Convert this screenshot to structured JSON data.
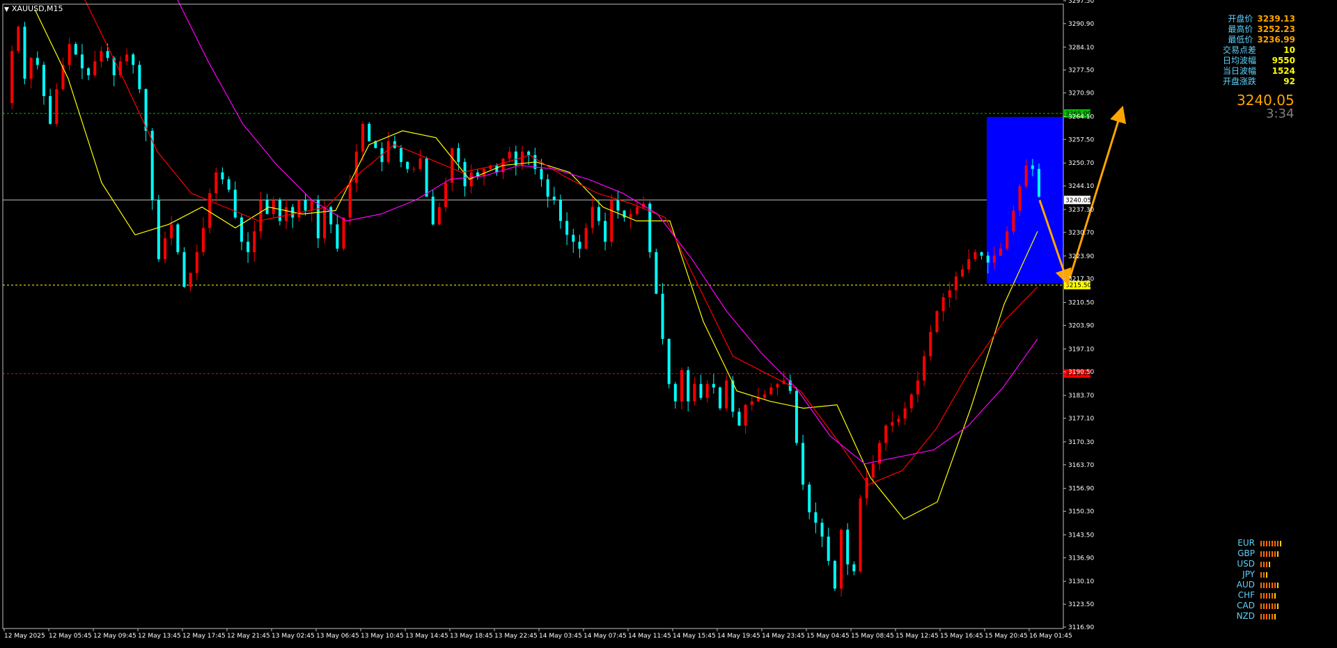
{
  "title": "XAUUSD,M15",
  "colors": {
    "background": "#000000",
    "bull_candle": "#ff0000",
    "bear_candle": "#00ffff",
    "ma_fast": "#ffff00",
    "ma_mid": "#ff0000",
    "ma_slow": "#ff00ff",
    "zone": "#0000ff",
    "arrow": "#ffa500",
    "level_high": "#00c000",
    "level_low": "#ffff00",
    "level_red": "#ff0000"
  },
  "info_panel": [
    {
      "label": "开盘价",
      "value": "3239.13",
      "color": "#ffa500"
    },
    {
      "label": "最高价",
      "value": "3252.23",
      "color": "#ffa500"
    },
    {
      "label": "最低价",
      "value": "3236.99",
      "color": "#ffa500"
    },
    {
      "label": "交易点差",
      "value": "10",
      "color": "#ffff00"
    },
    {
      "label": "日均波幅",
      "value": "9550",
      "color": "#ffff00"
    },
    {
      "label": "当日波幅",
      "value": "1524",
      "color": "#ffff00"
    },
    {
      "label": "开盘涨跌",
      "value": "92",
      "color": "#ffff00"
    }
  ],
  "current_price": "3240.05",
  "bar_timer": "3:34",
  "currency_strength": [
    {
      "code": "EUR",
      "strength": 8
    },
    {
      "code": "GBP",
      "strength": 7
    },
    {
      "code": "USD",
      "strength": 4
    },
    {
      "code": "JPY",
      "strength": 3
    },
    {
      "code": "AUD",
      "strength": 7
    },
    {
      "code": "CHF",
      "strength": 6
    },
    {
      "code": "CAD",
      "strength": 7
    },
    {
      "code": "NZD",
      "strength": 6
    }
  ],
  "chart_data": {
    "type": "candlestick",
    "symbol": "XAUUSD",
    "timeframe": "M15",
    "ylim": [
      3116.9,
      3297.5
    ],
    "y_ticks": [
      "3297.50",
      "3290.90",
      "3284.10",
      "3277.50",
      "3270.90",
      "3264.10",
      "3257.50",
      "3250.70",
      "3244.10",
      "3237.30",
      "3230.70",
      "3223.90",
      "3217.30",
      "3210.50",
      "3203.90",
      "3197.10",
      "3190.50",
      "3183.70",
      "3177.10",
      "3170.30",
      "3163.70",
      "3156.90",
      "3150.30",
      "3143.50",
      "3136.90",
      "3130.10",
      "3123.50",
      "3116.90"
    ],
    "x_ticks": [
      "12 May 2025",
      "12 May 05:45",
      "12 May 09:45",
      "12 May 13:45",
      "12 May 17:45",
      "12 May 21:45",
      "13 May 02:45",
      "13 May 06:45",
      "13 May 10:45",
      "13 May 14:45",
      "13 May 18:45",
      "13 May 22:45",
      "14 May 03:45",
      "14 May 07:45",
      "14 May 11:45",
      "14 May 15:45",
      "14 May 19:45",
      "14 May 23:45",
      "15 May 04:45",
      "15 May 08:45",
      "15 May 12:45",
      "15 May 16:45",
      "15 May 20:45",
      "16 May 01:45"
    ],
    "price_levels": [
      {
        "price": 3265.0,
        "label": "3265.00",
        "color": "#00c000"
      },
      {
        "price": 3240.05,
        "label": "3240.05",
        "color": "#c0c0c0"
      },
      {
        "price": 3215.5,
        "label": "3215.50",
        "color": "#ffff00"
      },
      {
        "price": 3190.0,
        "label": "3190.00",
        "color": "#ff0000"
      }
    ],
    "zone": {
      "top": 3264.0,
      "bottom": 3216.0,
      "start_x": "15 May 20:45"
    },
    "projection": [
      3240.0,
      3217.0,
      3265.5
    ],
    "close_path": [
      3268,
      3283,
      3290,
      3275,
      3281,
      3279,
      3270,
      3262,
      3272,
      3279,
      3285,
      3282,
      3278,
      3276,
      3280,
      3283,
      3281,
      3276,
      3280,
      3282,
      3279,
      3272,
      3260,
      3240,
      3223,
      3229,
      3233,
      3225,
      3215,
      3219,
      3225,
      3232,
      3242,
      3248,
      3246,
      3243,
      3235,
      3228,
      3225,
      3231,
      3240,
      3236,
      3240,
      3234,
      3238,
      3235,
      3240,
      3237,
      3240,
      3229,
      3238,
      3233,
      3226,
      3235,
      3245,
      3254,
      3262,
      3257,
      3255,
      3251,
      3257,
      3255,
      3251,
      3249,
      3249,
      3252,
      3241,
      3233,
      3238,
      3245,
      3255,
      3251,
      3244,
      3248,
      3247,
      3249,
      3250,
      3248,
      3252,
      3254,
      3250,
      3254,
      3253,
      3249,
      3246,
      3241,
      3240,
      3234,
      3230,
      3228,
      3226,
      3232,
      3238,
      3234,
      3228,
      3240,
      3237,
      3235,
      3236,
      3238,
      3239,
      3225,
      3213,
      3200,
      3187,
      3182,
      3191,
      3182,
      3187,
      3183,
      3187,
      3186,
      3180,
      3188,
      3179,
      3175,
      3181,
      3182,
      3183,
      3184,
      3186,
      3187,
      3188,
      3185,
      3170,
      3158,
      3150,
      3147,
      3143,
      3136,
      3128,
      3145,
      3135,
      3133,
      3154,
      3160,
      3164,
      3170,
      3175,
      3176,
      3177,
      3180,
      3184,
      3188,
      3195,
      3202,
      3208,
      3212,
      3214,
      3218,
      3220,
      3223,
      3225,
      3224,
      3222,
      3224,
      3226,
      3231,
      3237,
      3244,
      3250,
      3249,
      3241
    ],
    "ma_fast": [
      3295,
      3275,
      3245,
      3230,
      3233,
      3238,
      3232,
      3238,
      3236,
      3237,
      3256,
      3260,
      3258,
      3246,
      3250,
      3251,
      3248,
      3238,
      3234,
      3234,
      3205,
      3185,
      3182,
      3180,
      3181,
      3160,
      3148,
      3153,
      3180,
      3210,
      3231
    ],
    "ma_mid": [
      3315,
      3295,
      3275,
      3254,
      3242,
      3238,
      3234,
      3236,
      3238,
      3248,
      3256,
      3252,
      3248,
      3250,
      3253,
      3247,
      3242,
      3239,
      3235,
      3215,
      3195,
      3190,
      3185,
      3172,
      3158,
      3162,
      3174,
      3191,
      3205,
      3215
    ],
    "ma_slow": [
      3330,
      3315,
      3300,
      3280,
      3262,
      3250,
      3240,
      3234,
      3236,
      3240,
      3246,
      3247,
      3250,
      3249,
      3246,
      3242,
      3236,
      3223,
      3208,
      3196,
      3186,
      3172,
      3164,
      3166,
      3168,
      3175,
      3186,
      3200
    ]
  }
}
